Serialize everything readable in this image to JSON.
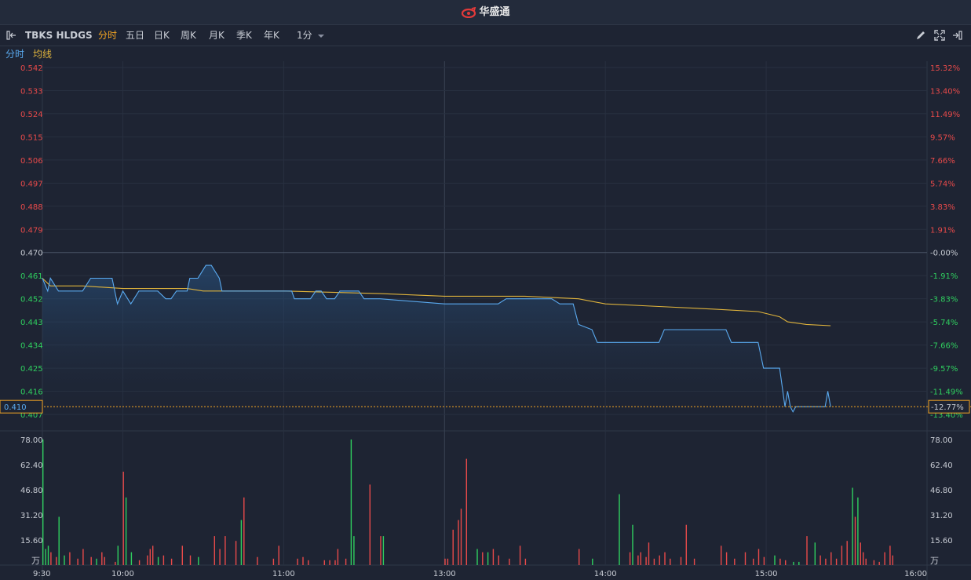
{
  "app": {
    "brand": "华盛通"
  },
  "toolbar": {
    "symbol": "TBKS HLDGS",
    "periods": [
      "分时",
      "五日",
      "日K",
      "周K",
      "月K",
      "季K",
      "年K"
    ],
    "active_period": "分时",
    "interval": "1分"
  },
  "legend": {
    "price_label": "分时",
    "avg_label": "均线"
  },
  "colors": {
    "background": "#1e2433",
    "price_line": "#5aaaf0",
    "avg_line": "#e0b43c",
    "up": "#e84a4a",
    "down": "#2fcf5f",
    "neutral": "#c8ccd4",
    "highlight": "#f5a623"
  },
  "chart_data": {
    "type": "line",
    "x_ticks": [
      "9:30",
      "10:00",
      "11:00",
      "13:00",
      "14:00",
      "15:00",
      "16:00"
    ],
    "ylim": [
      0.407,
      0.542
    ],
    "prev_close": 0.47,
    "price_ticks_left": [
      "0.542",
      "0.533",
      "0.524",
      "0.515",
      "0.506",
      "0.497",
      "0.488",
      "0.479",
      "0.470",
      "0.461",
      "0.452",
      "0.443",
      "0.434",
      "0.425",
      "0.416",
      "0.407"
    ],
    "pct_ticks_right": [
      "15.32%",
      "13.40%",
      "11.49%",
      "9.57%",
      "7.66%",
      "5.74%",
      "3.83%",
      "1.91%",
      "-0.00%",
      "-1.91%",
      "-3.83%",
      "-5.74%",
      "-7.66%",
      "-9.57%",
      "-11.49%",
      "-13.40%"
    ],
    "last_price": "0.410",
    "last_pct": "-12.77%",
    "series": [
      {
        "role": "price",
        "points": [
          [
            "9:30",
            0.46
          ],
          [
            "9:32",
            0.455
          ],
          [
            "9:33",
            0.46
          ],
          [
            "9:36",
            0.455
          ],
          [
            "9:45",
            0.455
          ],
          [
            "9:48",
            0.46
          ],
          [
            "9:56",
            0.46
          ],
          [
            "9:58",
            0.45
          ],
          [
            "10:00",
            0.455
          ],
          [
            "10:03",
            0.45
          ],
          [
            "10:06",
            0.455
          ],
          [
            "10:12",
            0.455
          ],
          [
            "10:13",
            0.455
          ],
          [
            "10:16",
            0.452
          ],
          [
            "10:18",
            0.452
          ],
          [
            "10:20",
            0.455
          ],
          [
            "10:24",
            0.455
          ],
          [
            "10:25",
            0.46
          ],
          [
            "10:28",
            0.46
          ],
          [
            "10:31",
            0.465
          ],
          [
            "10:33",
            0.465
          ],
          [
            "10:36",
            0.46
          ],
          [
            "10:37",
            0.455
          ],
          [
            "11:00",
            0.455
          ],
          [
            "11:03",
            0.455
          ],
          [
            "11:04",
            0.452
          ],
          [
            "11:10",
            0.452
          ],
          [
            "11:12",
            0.455
          ],
          [
            "11:14",
            0.455
          ],
          [
            "11:16",
            0.452
          ],
          [
            "11:19",
            0.452
          ],
          [
            "11:21",
            0.455
          ],
          [
            "11:28",
            0.455
          ],
          [
            "11:30",
            0.452
          ],
          [
            "11:36",
            0.452
          ],
          [
            "13:00",
            0.45
          ],
          [
            "13:20",
            0.45
          ],
          [
            "13:23",
            0.452
          ],
          [
            "13:40",
            0.452
          ],
          [
            "13:43",
            0.45
          ],
          [
            "13:48",
            0.45
          ],
          [
            "13:50",
            0.442
          ],
          [
            "13:55",
            0.44
          ],
          [
            "13:57",
            0.435
          ],
          [
            "14:20",
            0.435
          ],
          [
            "14:22",
            0.44
          ],
          [
            "14:45",
            0.44
          ],
          [
            "14:47",
            0.435
          ],
          [
            "14:57",
            0.435
          ],
          [
            "14:59",
            0.425
          ],
          [
            "15:05",
            0.425
          ],
          [
            "15:07",
            0.41
          ],
          [
            "15:08",
            0.416
          ],
          [
            "15:09",
            0.41
          ],
          [
            "15:10",
            0.408
          ],
          [
            "15:11",
            0.41
          ],
          [
            "15:22",
            0.41
          ],
          [
            "15:23",
            0.416
          ],
          [
            "15:24",
            0.41
          ]
        ]
      },
      {
        "role": "average",
        "points": [
          [
            "9:30",
            0.46
          ],
          [
            "9:33",
            0.457
          ],
          [
            "9:45",
            0.457
          ],
          [
            "10:00",
            0.456
          ],
          [
            "10:24",
            0.456
          ],
          [
            "10:30",
            0.455
          ],
          [
            "11:00",
            0.455
          ],
          [
            "11:36",
            0.454
          ],
          [
            "13:00",
            0.453
          ],
          [
            "13:30",
            0.453
          ],
          [
            "13:50",
            0.452
          ],
          [
            "14:00",
            0.45
          ],
          [
            "14:20",
            0.449
          ],
          [
            "14:40",
            0.448
          ],
          [
            "14:57",
            0.447
          ],
          [
            "15:05",
            0.445
          ],
          [
            "15:08",
            0.443
          ],
          [
            "15:15",
            0.442
          ],
          [
            "15:24",
            0.4415
          ]
        ]
      }
    ],
    "volume": {
      "unit": "万",
      "ylim": [
        0,
        78
      ],
      "y_ticks": [
        "78.00",
        "62.40",
        "46.80",
        "31.20",
        "15.60"
      ],
      "bars": [
        [
          "9:30",
          78,
          "down"
        ],
        [
          "9:31",
          10,
          "down"
        ],
        [
          "9:32",
          12,
          "down"
        ],
        [
          "9:33",
          8,
          "up"
        ],
        [
          "9:35",
          5,
          "up"
        ],
        [
          "9:36",
          30,
          "down"
        ],
        [
          "9:38",
          6,
          "down"
        ],
        [
          "9:40",
          8,
          "up"
        ],
        [
          "9:43",
          4,
          "up"
        ],
        [
          "9:45",
          10,
          "up"
        ],
        [
          "9:48",
          5,
          "up"
        ],
        [
          "9:50",
          4,
          "down"
        ],
        [
          "9:52",
          8,
          "up"
        ],
        [
          "9:53",
          5,
          "up"
        ],
        [
          "9:57",
          2,
          "up"
        ],
        [
          "9:58",
          12,
          "down"
        ],
        [
          "10:00",
          58,
          "up"
        ],
        [
          "10:01",
          42,
          "down"
        ],
        [
          "10:03",
          8,
          "down"
        ],
        [
          "10:06",
          3,
          "up"
        ],
        [
          "10:09",
          6,
          "up"
        ],
        [
          "10:10",
          10,
          "up"
        ],
        [
          "10:11",
          12,
          "up"
        ],
        [
          "10:13",
          5,
          "down"
        ],
        [
          "10:15",
          6,
          "up"
        ],
        [
          "10:18",
          4,
          "up"
        ],
        [
          "10:22",
          12,
          "up"
        ],
        [
          "10:25",
          6,
          "up"
        ],
        [
          "10:28",
          5,
          "down"
        ],
        [
          "10:34",
          18,
          "up"
        ],
        [
          "10:36",
          10,
          "up"
        ],
        [
          "10:38",
          18,
          "up"
        ],
        [
          "10:42",
          15,
          "up"
        ],
        [
          "10:44",
          28,
          "down"
        ],
        [
          "10:45",
          42,
          "up"
        ],
        [
          "10:50",
          5,
          "up"
        ],
        [
          "10:56",
          4,
          "up"
        ],
        [
          "10:58",
          12,
          "up"
        ],
        [
          "11:05",
          4,
          "up"
        ],
        [
          "11:07",
          5,
          "up"
        ],
        [
          "11:09",
          3,
          "up"
        ],
        [
          "11:15",
          3,
          "up"
        ],
        [
          "11:17",
          3,
          "up"
        ],
        [
          "11:19",
          3,
          "up"
        ],
        [
          "11:20",
          10,
          "up"
        ],
        [
          "11:23",
          4,
          "up"
        ],
        [
          "11:25",
          78,
          "down"
        ],
        [
          "11:26",
          18,
          "down"
        ],
        [
          "11:32",
          50,
          "up"
        ],
        [
          "11:36",
          18,
          "up"
        ],
        [
          "11:37",
          18,
          "down"
        ],
        [
          "13:00",
          4,
          "up"
        ],
        [
          "13:01",
          4,
          "up"
        ],
        [
          "13:03",
          22,
          "up"
        ],
        [
          "13:05",
          28,
          "up"
        ],
        [
          "13:06",
          35,
          "up"
        ],
        [
          "13:08",
          66,
          "up"
        ],
        [
          "13:12",
          10,
          "down"
        ],
        [
          "13:14",
          8,
          "up"
        ],
        [
          "13:16",
          8,
          "down"
        ],
        [
          "13:18",
          10,
          "up"
        ],
        [
          "13:20",
          6,
          "up"
        ],
        [
          "13:24",
          4,
          "up"
        ],
        [
          "13:28",
          12,
          "up"
        ],
        [
          "13:30",
          4,
          "up"
        ],
        [
          "13:50",
          10,
          "up"
        ],
        [
          "13:55",
          4,
          "down"
        ],
        [
          "14:05",
          44,
          "down"
        ],
        [
          "14:09",
          8,
          "up"
        ],
        [
          "14:10",
          25,
          "down"
        ],
        [
          "14:12",
          6,
          "up"
        ],
        [
          "14:13",
          8,
          "up"
        ],
        [
          "14:15",
          5,
          "up"
        ],
        [
          "14:16",
          14,
          "up"
        ],
        [
          "14:18",
          4,
          "up"
        ],
        [
          "14:20",
          6,
          "up"
        ],
        [
          "14:22",
          8,
          "up"
        ],
        [
          "14:24",
          4,
          "up"
        ],
        [
          "14:28",
          5,
          "up"
        ],
        [
          "14:30",
          25,
          "up"
        ],
        [
          "14:33",
          4,
          "up"
        ],
        [
          "14:43",
          12,
          "up"
        ],
        [
          "14:45",
          8,
          "up"
        ],
        [
          "14:48",
          4,
          "up"
        ],
        [
          "14:52",
          8,
          "up"
        ],
        [
          "14:55",
          4,
          "up"
        ],
        [
          "14:57",
          10,
          "up"
        ],
        [
          "14:59",
          5,
          "up"
        ],
        [
          "15:03",
          6,
          "down"
        ],
        [
          "15:05",
          4,
          "up"
        ],
        [
          "15:07",
          3,
          "up"
        ],
        [
          "15:10",
          2,
          "down"
        ],
        [
          "15:12",
          2,
          "down"
        ],
        [
          "15:15",
          18,
          "up"
        ],
        [
          "15:18",
          14,
          "down"
        ],
        [
          "15:20",
          6,
          "up"
        ],
        [
          "15:22",
          4,
          "up"
        ],
        [
          "15:24",
          8,
          "up"
        ],
        [
          "15:26",
          4,
          "up"
        ],
        [
          "15:28",
          12,
          "up"
        ],
        [
          "15:30",
          15,
          "up"
        ],
        [
          "15:32",
          48,
          "down"
        ],
        [
          "15:33",
          30,
          "up"
        ],
        [
          "15:34",
          42,
          "down"
        ],
        [
          "15:35",
          14,
          "up"
        ],
        [
          "15:36",
          8,
          "up"
        ],
        [
          "15:37",
          4,
          "up"
        ],
        [
          "15:40",
          3,
          "up"
        ],
        [
          "15:42",
          2,
          "up"
        ],
        [
          "15:44",
          8,
          "up"
        ],
        [
          "15:46",
          12,
          "up"
        ],
        [
          "15:47",
          6,
          "up"
        ]
      ]
    }
  }
}
